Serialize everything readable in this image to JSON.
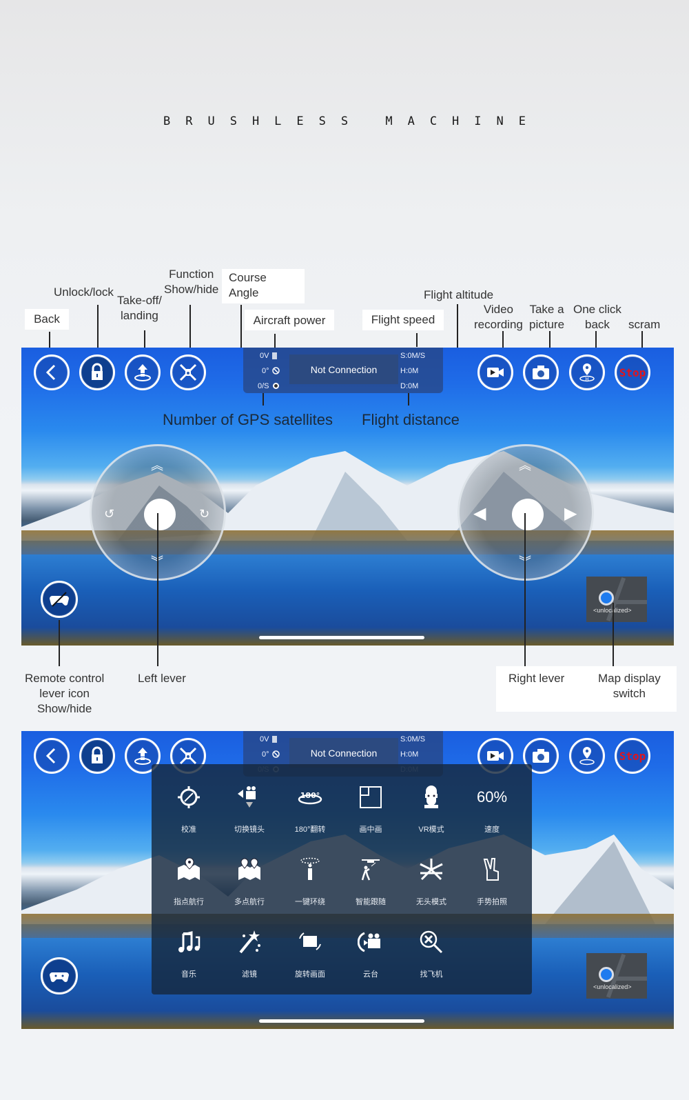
{
  "page": {
    "title": "BRUSHLESS MACHINE"
  },
  "annotations": {
    "back": "Back",
    "unlock_lock": "Unlock/lock",
    "takeoff_landing_1": "Take-off/",
    "takeoff_landing_2": "landing",
    "function_1": "Function",
    "function_2": "Show/hide",
    "course_1": "Course",
    "course_2": "Angle",
    "aircraft_power": "Aircraft power",
    "flight_speed": "Flight speed",
    "flight_altitude": "Flight altitude",
    "video_1": "Video",
    "video_2": "recording",
    "picture_1": "Take a",
    "picture_2": "picture",
    "oneclick_1": "One click",
    "oneclick_2": "back",
    "scram": "scram",
    "gps_sats": "Number of GPS satellites",
    "flight_distance": "Flight distance",
    "remote_1": "Remote control",
    "remote_2": "lever icon",
    "remote_3": "Show/hide",
    "left_lever": "Left lever",
    "right_lever": "Right lever",
    "map_1": "Map display",
    "map_2": "switch"
  },
  "screen": {
    "buttons": {
      "back": "back-icon",
      "lock": "lock-icon",
      "takeoff": "takeoff-icon",
      "function": "drone-icon",
      "video": "video-camera-icon",
      "photo": "camera-icon",
      "return_home": "home-pin-icon",
      "stop_label": "Stop"
    },
    "status": {
      "power": "0V",
      "course_angle": "0°",
      "gps": "0/S",
      "speed": "S:0M/S",
      "altitude": "H:0M",
      "distance": "D:0M",
      "connection": "Not Connection"
    },
    "map_text": "<unlocalized>",
    "accent_color": "#1e7bef",
    "stop_color": "#e0151d"
  },
  "function_panel": {
    "items": [
      {
        "label": "校准",
        "icon": "calibrate-icon"
      },
      {
        "label": "切换镜头",
        "icon": "switch-lens-icon"
      },
      {
        "label": "180°翻转",
        "icon": "flip-180-icon",
        "icon_text": "180°"
      },
      {
        "label": "画中画",
        "icon": "picture-in-picture-icon"
      },
      {
        "label": "VR模式",
        "icon": "vr-mode-icon"
      },
      {
        "label": "速度",
        "icon": "speed-value",
        "value": "60%"
      },
      {
        "label": "指点航行",
        "icon": "point-navigation-icon"
      },
      {
        "label": "多点航行",
        "icon": "multipoint-navigation-icon"
      },
      {
        "label": "一键环绕",
        "icon": "orbit-icon"
      },
      {
        "label": "智能跟随",
        "icon": "follow-me-icon"
      },
      {
        "label": "无头模式",
        "icon": "headless-mode-icon"
      },
      {
        "label": "手势拍照",
        "icon": "gesture-photo-icon"
      },
      {
        "label": "音乐",
        "icon": "music-icon"
      },
      {
        "label": "滤镜",
        "icon": "filter-wand-icon"
      },
      {
        "label": "旋转画面",
        "icon": "rotate-screen-icon"
      },
      {
        "label": "云台",
        "icon": "gimbal-icon"
      },
      {
        "label": "找飞机",
        "icon": "find-drone-icon"
      }
    ]
  }
}
